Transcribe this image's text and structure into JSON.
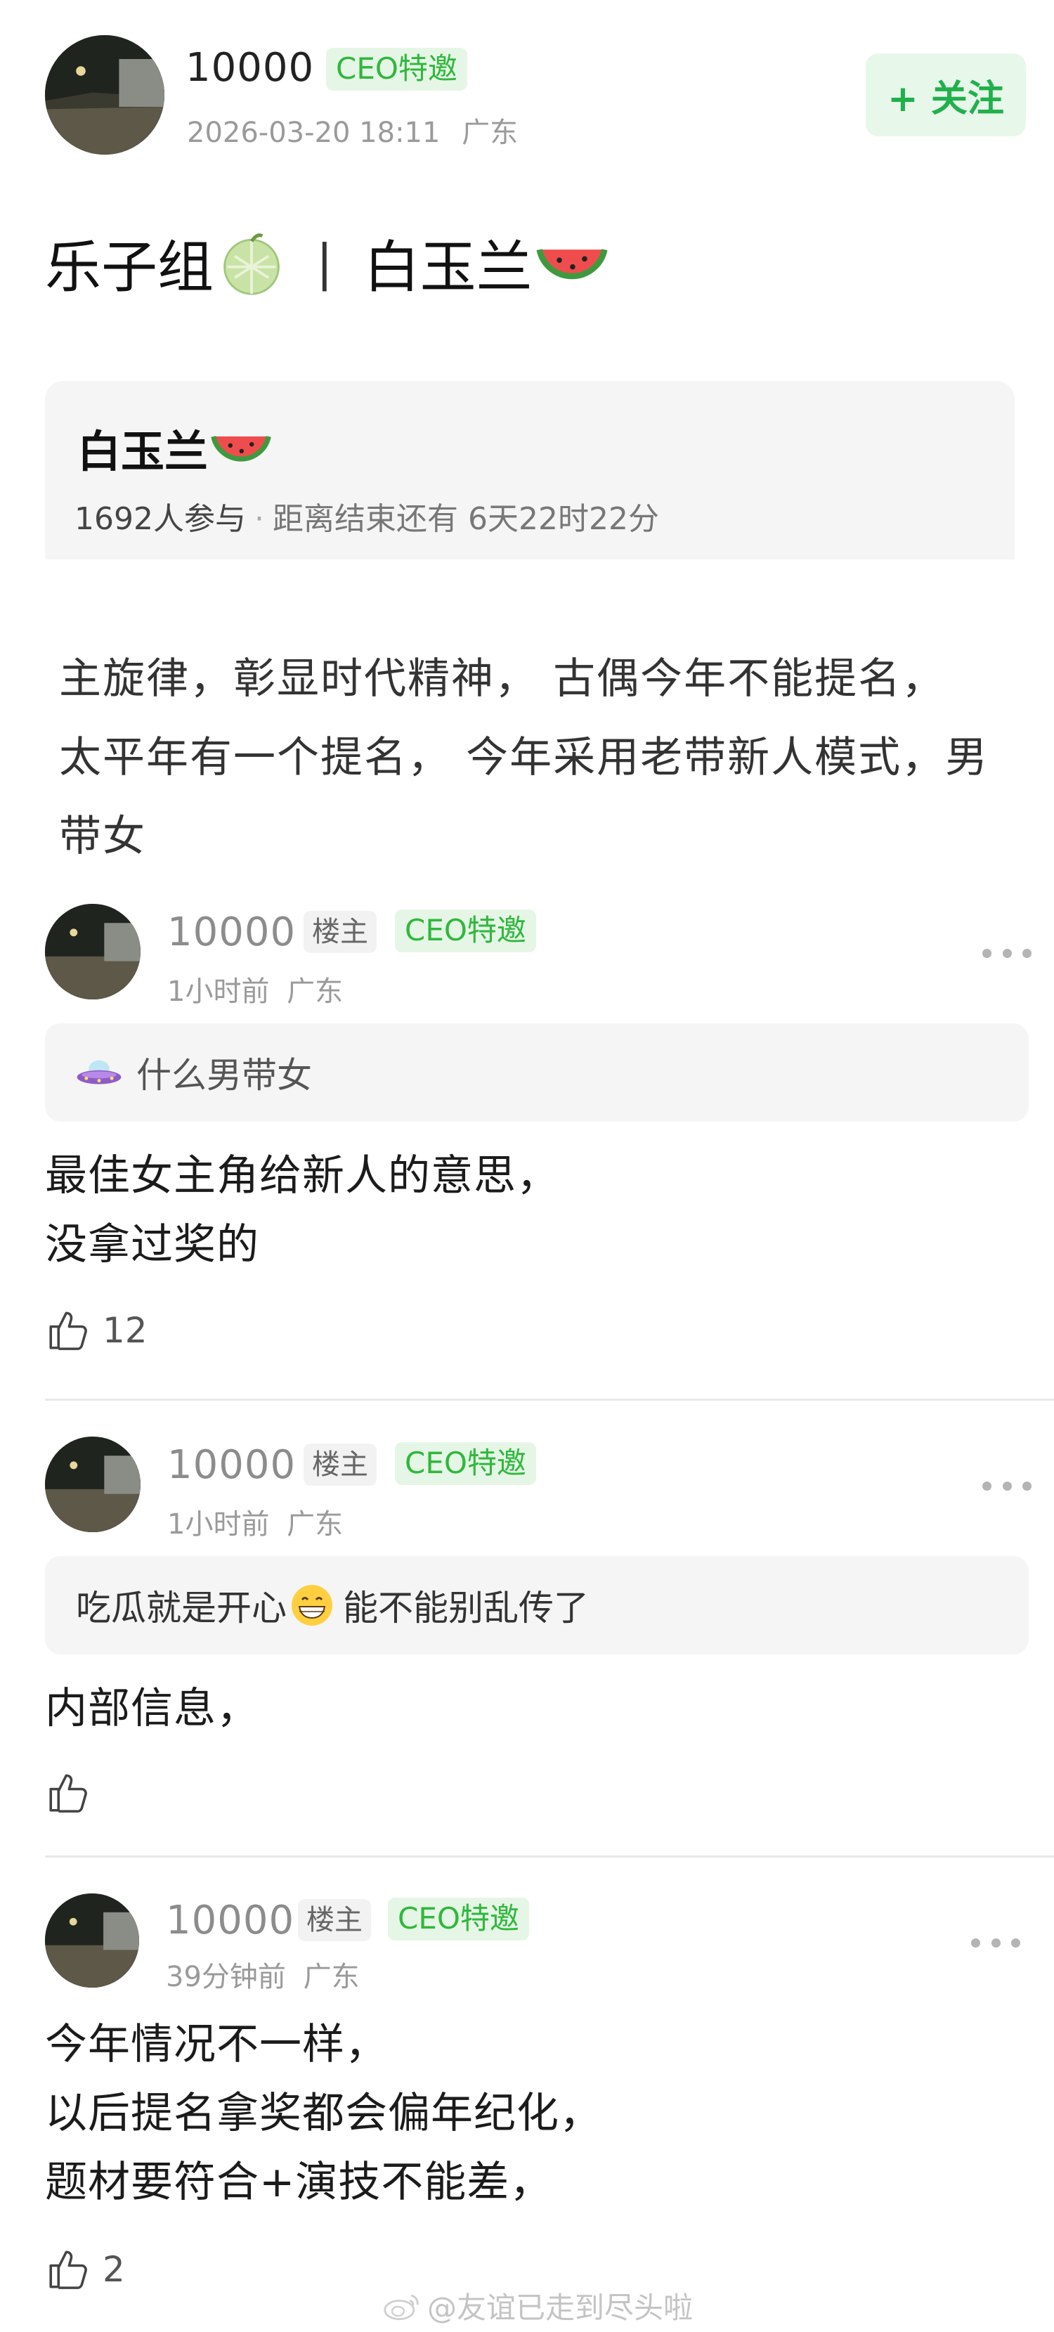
{
  "post": {
    "author": "10000",
    "ceo_badge": "CEO特邀",
    "time": "2026-03-20 18:11",
    "location": "广东",
    "follow_label": "+ 关注",
    "title_left": "乐子组",
    "title_sep": "|",
    "title_right": "白玉兰",
    "body": "主旋律，彰显时代精神， 古偶今年不能提名， 太平年有一个提名， 今年采用老带新人模式，男带女"
  },
  "topic": {
    "name": "白玉兰",
    "participants": "1692人参与",
    "dot": "·",
    "countdown": "距离结束还有 6天22时22分"
  },
  "comments": [
    {
      "author": "10000",
      "owner_badge": "楼主",
      "ceo_badge": "CEO特邀",
      "time": "1小时前",
      "location": "广东",
      "quote": "什么男带女",
      "text": "最佳女主角给新人的意思，\n没拿过奖的",
      "likes": "12"
    },
    {
      "author": "10000",
      "owner_badge": "楼主",
      "ceo_badge": "CEO特邀",
      "time": "1小时前",
      "location": "广东",
      "quote_before": "吃瓜就是开心",
      "quote_after": "能不能别乱传了",
      "text": "内部信息，",
      "likes": ""
    },
    {
      "author": "10000",
      "owner_badge": "楼主",
      "ceo_badge": "CEO特邀",
      "time": "39分钟前",
      "location": "广东",
      "text": "今年情况不一样，\n以后提名拿奖都会偏年纪化，\n题材要符合+演技不能差，",
      "likes": "2"
    }
  ],
  "watermark": "@友谊已走到尽头啦",
  "icons": {
    "title_left_emoji": "melon-icon",
    "title_right_emoji": "watermelon-icon",
    "quote1": "ufo-icon",
    "quote2": "grinning-face-icon",
    "like": "thumbs-up-icon",
    "more": "more-dots-icon",
    "watermark": "weibo-icon"
  },
  "colors": {
    "accent_green": "#21b04b",
    "badge_green_text": "#2fb83c",
    "badge_green_bg": "#e6f6e6",
    "meta_gray": "#9a9a9a"
  }
}
